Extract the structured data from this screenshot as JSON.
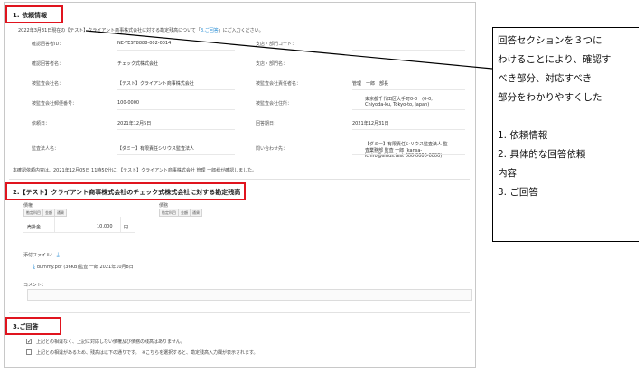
{
  "section1": {
    "title": "1. 依頼情報",
    "intro": "2022年3月31日現在の【テスト】クライアント商事株式会社に対する勘定残高について「",
    "intro_link": "3.ご回答",
    "intro_tail": "」にご入力ください。",
    "fields_left": [
      {
        "label": "確認回答者ID：",
        "value": "NE-TEST8888-002-0014"
      },
      {
        "label": "確認回答者名：",
        "value": "チェック式株式会社"
      },
      {
        "label": "被監査会社名：",
        "value": "【テスト】クライアント商事株式会社"
      },
      {
        "label": "被監査会社郵便番号：",
        "value": "100-0000"
      },
      {
        "label": "依頼日：",
        "value": "2021年12月5日"
      },
      {
        "label": "監査法人名：",
        "value": "【ダミー】有限責任シリウス監査法人"
      }
    ],
    "fields_right": [
      {
        "label": "支店・部門コード：",
        "value": ""
      },
      {
        "label": "支店・部門名：",
        "value": ""
      },
      {
        "label": "被監査会社責任者名：",
        "value": "管理　一郎　部長"
      },
      {
        "label": "被監査会社住所：",
        "value_lines": [
          "東京都千代田区大手町0-0　(0-0,",
          "Chiyoda-ku, Tokyo-to, Japan)"
        ]
      },
      {
        "label": "回答期日：",
        "value": "2021年12月31日"
      },
      {
        "label": "問い合わせ先：",
        "value_lines": [
          "【ダミー】有限責任シリウス監査法人 監",
          "査業務部 監査 一郎 (kansa-",
          "ichiro@sirius.test 000-0000-0000)"
        ]
      }
    ],
    "confirm_text": "本確認依頼内容は、2021年12月05日 11時50分に、【テスト】クライアント商事株式会社 管理 一郎様が確認しました。"
  },
  "section2": {
    "title": "2.【テスト】クライアント商事株式会社のチェック式株式会社に対する勘定残高",
    "receivable_label": "債権",
    "payable_label": "債務",
    "table_headers": [
      "勘定科目",
      "金額",
      "通貨"
    ],
    "receivable_rows": [
      {
        "account": "売掛金",
        "amount": "10,000",
        "currency": "円"
      }
    ],
    "attachment_label": "添付ファイル：",
    "attachment_file": "dummy.pdf (36KB)監査 一郎 2021年10月8日",
    "comment_label": "コメント："
  },
  "section3": {
    "title": "3.ご回答",
    "option1": "上記との相違なく、上記に対応しない債権及び債務の残高はありません。",
    "option2": "上記との相違があるため、残高は以下の通りです。　※こちらを選択すると、勘定残高入力欄が表示されます。"
  },
  "note": {
    "lines": [
      "回答セクションを３つに",
      "わけることにより、確認す",
      "べき部分、対応すべき",
      "部分をわかりやすくした",
      "",
      "1.  依頼情報",
      "2.  具体的な回答依頼",
      "内容",
      "3.  ご回答"
    ]
  },
  "colors": {
    "highlight": "#e0141e",
    "link": "#2b8fd6"
  }
}
